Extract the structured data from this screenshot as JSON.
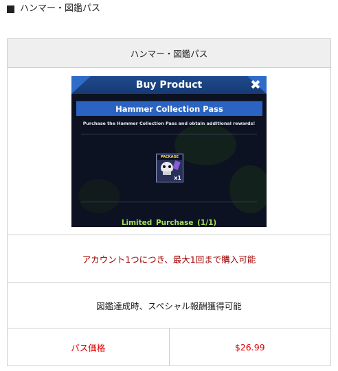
{
  "heading": "ハンマー・図鑑パス",
  "table": {
    "title": "ハンマー・図鑑パス",
    "limit_note": "アカウント1つにつき、最大1回まで購入可能",
    "description": "図鑑達成時、スペシャル報酬獲得可能",
    "price_label": "パス価格",
    "price_value": "$26.99"
  },
  "dialog": {
    "title": "Buy Product",
    "product_name": "Hammer Collection Pass",
    "description": "Purchase the Hammer Collection Pass and obtain additional rewards!",
    "item_badge": "PACKAGE",
    "item_quantity": "x1",
    "purchase_limit_label": "Limited Purchase",
    "purchase_limit_count": "(1/1)"
  },
  "colors": {
    "limit_text": "#a10000",
    "price_text": "#e00000",
    "dialog_bg": "#0c1221",
    "dialog_banner": "#2a63c2",
    "limited_text": "#a6e05a"
  },
  "icons": {
    "heading_bullet": "black-square",
    "dialog_close": "close-icon"
  }
}
